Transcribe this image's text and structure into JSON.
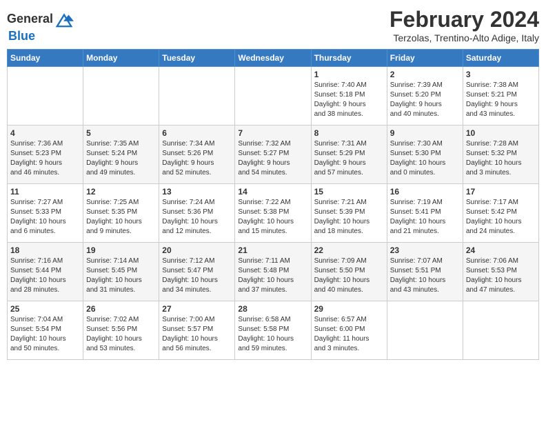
{
  "header": {
    "logo_line1": "General",
    "logo_line2": "Blue",
    "month": "February 2024",
    "location": "Terzolas, Trentino-Alto Adige, Italy"
  },
  "days_of_week": [
    "Sunday",
    "Monday",
    "Tuesday",
    "Wednesday",
    "Thursday",
    "Friday",
    "Saturday"
  ],
  "weeks": [
    [
      {
        "day": "",
        "info": ""
      },
      {
        "day": "",
        "info": ""
      },
      {
        "day": "",
        "info": ""
      },
      {
        "day": "",
        "info": ""
      },
      {
        "day": "1",
        "info": "Sunrise: 7:40 AM\nSunset: 5:18 PM\nDaylight: 9 hours\nand 38 minutes."
      },
      {
        "day": "2",
        "info": "Sunrise: 7:39 AM\nSunset: 5:20 PM\nDaylight: 9 hours\nand 40 minutes."
      },
      {
        "day": "3",
        "info": "Sunrise: 7:38 AM\nSunset: 5:21 PM\nDaylight: 9 hours\nand 43 minutes."
      }
    ],
    [
      {
        "day": "4",
        "info": "Sunrise: 7:36 AM\nSunset: 5:23 PM\nDaylight: 9 hours\nand 46 minutes."
      },
      {
        "day": "5",
        "info": "Sunrise: 7:35 AM\nSunset: 5:24 PM\nDaylight: 9 hours\nand 49 minutes."
      },
      {
        "day": "6",
        "info": "Sunrise: 7:34 AM\nSunset: 5:26 PM\nDaylight: 9 hours\nand 52 minutes."
      },
      {
        "day": "7",
        "info": "Sunrise: 7:32 AM\nSunset: 5:27 PM\nDaylight: 9 hours\nand 54 minutes."
      },
      {
        "day": "8",
        "info": "Sunrise: 7:31 AM\nSunset: 5:29 PM\nDaylight: 9 hours\nand 57 minutes."
      },
      {
        "day": "9",
        "info": "Sunrise: 7:30 AM\nSunset: 5:30 PM\nDaylight: 10 hours\nand 0 minutes."
      },
      {
        "day": "10",
        "info": "Sunrise: 7:28 AM\nSunset: 5:32 PM\nDaylight: 10 hours\nand 3 minutes."
      }
    ],
    [
      {
        "day": "11",
        "info": "Sunrise: 7:27 AM\nSunset: 5:33 PM\nDaylight: 10 hours\nand 6 minutes."
      },
      {
        "day": "12",
        "info": "Sunrise: 7:25 AM\nSunset: 5:35 PM\nDaylight: 10 hours\nand 9 minutes."
      },
      {
        "day": "13",
        "info": "Sunrise: 7:24 AM\nSunset: 5:36 PM\nDaylight: 10 hours\nand 12 minutes."
      },
      {
        "day": "14",
        "info": "Sunrise: 7:22 AM\nSunset: 5:38 PM\nDaylight: 10 hours\nand 15 minutes."
      },
      {
        "day": "15",
        "info": "Sunrise: 7:21 AM\nSunset: 5:39 PM\nDaylight: 10 hours\nand 18 minutes."
      },
      {
        "day": "16",
        "info": "Sunrise: 7:19 AM\nSunset: 5:41 PM\nDaylight: 10 hours\nand 21 minutes."
      },
      {
        "day": "17",
        "info": "Sunrise: 7:17 AM\nSunset: 5:42 PM\nDaylight: 10 hours\nand 24 minutes."
      }
    ],
    [
      {
        "day": "18",
        "info": "Sunrise: 7:16 AM\nSunset: 5:44 PM\nDaylight: 10 hours\nand 28 minutes."
      },
      {
        "day": "19",
        "info": "Sunrise: 7:14 AM\nSunset: 5:45 PM\nDaylight: 10 hours\nand 31 minutes."
      },
      {
        "day": "20",
        "info": "Sunrise: 7:12 AM\nSunset: 5:47 PM\nDaylight: 10 hours\nand 34 minutes."
      },
      {
        "day": "21",
        "info": "Sunrise: 7:11 AM\nSunset: 5:48 PM\nDaylight: 10 hours\nand 37 minutes."
      },
      {
        "day": "22",
        "info": "Sunrise: 7:09 AM\nSunset: 5:50 PM\nDaylight: 10 hours\nand 40 minutes."
      },
      {
        "day": "23",
        "info": "Sunrise: 7:07 AM\nSunset: 5:51 PM\nDaylight: 10 hours\nand 43 minutes."
      },
      {
        "day": "24",
        "info": "Sunrise: 7:06 AM\nSunset: 5:53 PM\nDaylight: 10 hours\nand 47 minutes."
      }
    ],
    [
      {
        "day": "25",
        "info": "Sunrise: 7:04 AM\nSunset: 5:54 PM\nDaylight: 10 hours\nand 50 minutes."
      },
      {
        "day": "26",
        "info": "Sunrise: 7:02 AM\nSunset: 5:56 PM\nDaylight: 10 hours\nand 53 minutes."
      },
      {
        "day": "27",
        "info": "Sunrise: 7:00 AM\nSunset: 5:57 PM\nDaylight: 10 hours\nand 56 minutes."
      },
      {
        "day": "28",
        "info": "Sunrise: 6:58 AM\nSunset: 5:58 PM\nDaylight: 10 hours\nand 59 minutes."
      },
      {
        "day": "29",
        "info": "Sunrise: 6:57 AM\nSunset: 6:00 PM\nDaylight: 11 hours\nand 3 minutes."
      },
      {
        "day": "",
        "info": ""
      },
      {
        "day": "",
        "info": ""
      }
    ]
  ]
}
